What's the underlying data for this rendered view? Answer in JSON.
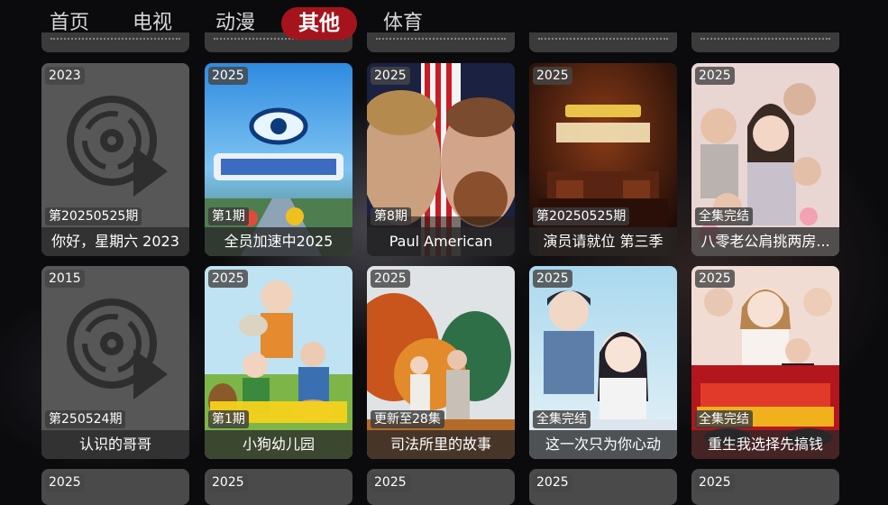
{
  "tabs": [
    {
      "label": "首页",
      "active": false
    },
    {
      "label": "电视",
      "active": false
    },
    {
      "label": "动漫",
      "active": false
    },
    {
      "label": "其他",
      "active": true
    },
    {
      "label": "体育",
      "active": false
    }
  ],
  "accent_color": "#a5141d",
  "rows": [
    [
      {
        "year": "2023",
        "episode": "第20250525期",
        "title": "你好，星期六 2023",
        "poster": "placeholder-disc-icon"
      },
      {
        "year": "2025",
        "episode": "第1期",
        "title": "全员加速中2025",
        "poster": "show-poster"
      },
      {
        "year": "2025",
        "episode": "第8期",
        "title": "Paul American",
        "poster": "boxing-poster"
      },
      {
        "year": "2025",
        "episode": "第20250525期",
        "title": "演员请就位 第三季",
        "poster": "theater-poster"
      },
      {
        "year": "2025",
        "episode": "全集完结",
        "title": "八零老公肩挑两房...",
        "poster": "drama-poster"
      }
    ],
    [
      {
        "year": "2015",
        "episode": "第250524期",
        "title": "认识的哥哥",
        "poster": "placeholder-disc-icon"
      },
      {
        "year": "2025",
        "episode": "第1期",
        "title": "小狗幼儿园",
        "poster": "dog-show-poster"
      },
      {
        "year": "2025",
        "episode": "更新至28集",
        "title": "司法所里的故事",
        "poster": "autumn-poster"
      },
      {
        "year": "2025",
        "episode": "全集完结",
        "title": "这一次只为你心动",
        "poster": "romance-poster"
      },
      {
        "year": "2025",
        "episode": "全集完结",
        "title": "重生我选择先搞钱",
        "poster": "money-drama-poster"
      }
    ],
    [
      {
        "year": "2025"
      },
      {
        "year": "2025"
      },
      {
        "year": "2025"
      },
      {
        "year": "2025"
      },
      {
        "year": "2025"
      }
    ]
  ]
}
